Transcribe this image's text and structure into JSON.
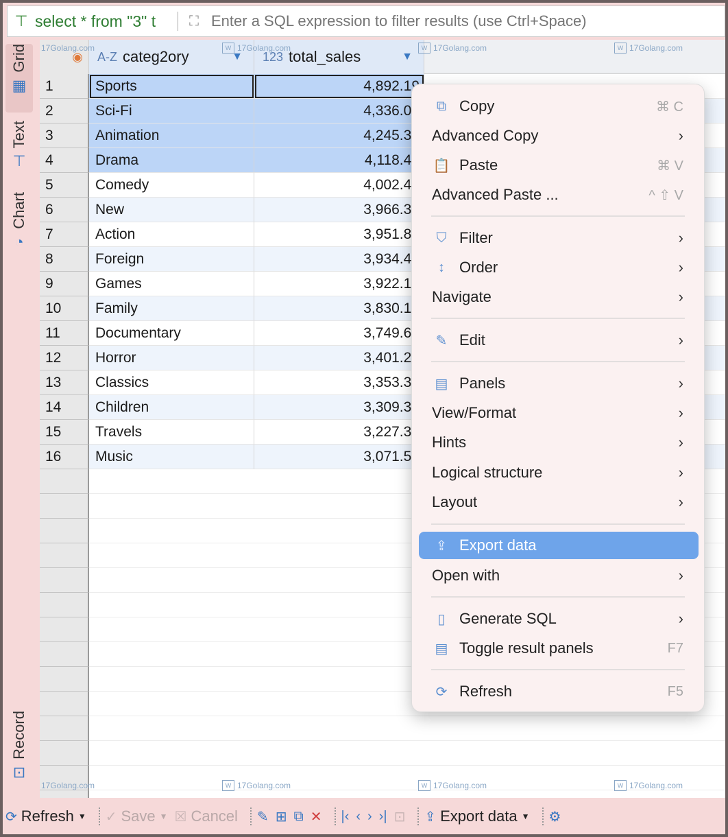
{
  "filter_bar": {
    "query_text": "select * from \"3\" t",
    "placeholder": "Enter a SQL expression to filter results (use Ctrl+Space)"
  },
  "side_tabs": [
    "Grid",
    "Text",
    "Chart",
    "Record"
  ],
  "columns": [
    {
      "type": "A-Z",
      "name": "categ2ory"
    },
    {
      "type": "123",
      "name": "total_sales"
    }
  ],
  "rows": [
    {
      "num": "1",
      "category": "Sports",
      "sales": "4,892.19"
    },
    {
      "num": "2",
      "category": "Sci-Fi",
      "sales": "4,336.01"
    },
    {
      "num": "3",
      "category": "Animation",
      "sales": "4,245.31"
    },
    {
      "num": "4",
      "category": "Drama",
      "sales": "4,118.46"
    },
    {
      "num": "5",
      "category": "Comedy",
      "sales": "4,002.48"
    },
    {
      "num": "6",
      "category": "New",
      "sales": "3,966.38"
    },
    {
      "num": "7",
      "category": "Action",
      "sales": "3,951.84"
    },
    {
      "num": "8",
      "category": "Foreign",
      "sales": "3,934.47"
    },
    {
      "num": "9",
      "category": "Games",
      "sales": "3,922.18"
    },
    {
      "num": "10",
      "category": "Family",
      "sales": "3,830.15"
    },
    {
      "num": "11",
      "category": "Documentary",
      "sales": "3,749.65"
    },
    {
      "num": "12",
      "category": "Horror",
      "sales": "3,401.27"
    },
    {
      "num": "13",
      "category": "Classics",
      "sales": "3,353.38"
    },
    {
      "num": "14",
      "category": "Children",
      "sales": "3,309.39"
    },
    {
      "num": "15",
      "category": "Travels",
      "sales": "3,227.36"
    },
    {
      "num": "16",
      "category": "Music",
      "sales": "3,071.52"
    }
  ],
  "watermark": "17Golang.com",
  "context_menu": {
    "copy": {
      "label": "Copy",
      "shortcut": "⌘ C"
    },
    "advanced_copy": {
      "label": "Advanced Copy"
    },
    "paste": {
      "label": "Paste",
      "shortcut": "⌘ V"
    },
    "advanced_paste": {
      "label": "Advanced Paste ...",
      "shortcut": "^ ⇧ V"
    },
    "filter": {
      "label": "Filter"
    },
    "order": {
      "label": "Order"
    },
    "navigate": {
      "label": "Navigate"
    },
    "edit": {
      "label": "Edit"
    },
    "panels": {
      "label": "Panels"
    },
    "view_format": {
      "label": "View/Format"
    },
    "hints": {
      "label": "Hints"
    },
    "logical_structure": {
      "label": "Logical structure"
    },
    "layout": {
      "label": "Layout"
    },
    "export_data": {
      "label": "Export data"
    },
    "open_with": {
      "label": "Open with"
    },
    "generate_sql": {
      "label": "Generate SQL"
    },
    "toggle_result_panels": {
      "label": "Toggle result panels",
      "shortcut": "F7"
    },
    "refresh": {
      "label": "Refresh",
      "shortcut": "F5"
    }
  },
  "toolbar": {
    "refresh": "Refresh",
    "save": "Save",
    "cancel": "Cancel",
    "export_data": "Export data"
  },
  "colors": {
    "selection": "#bcd5f7",
    "menu_highlight": "#6ea4ea",
    "frame_background": "#f6d9d9"
  }
}
